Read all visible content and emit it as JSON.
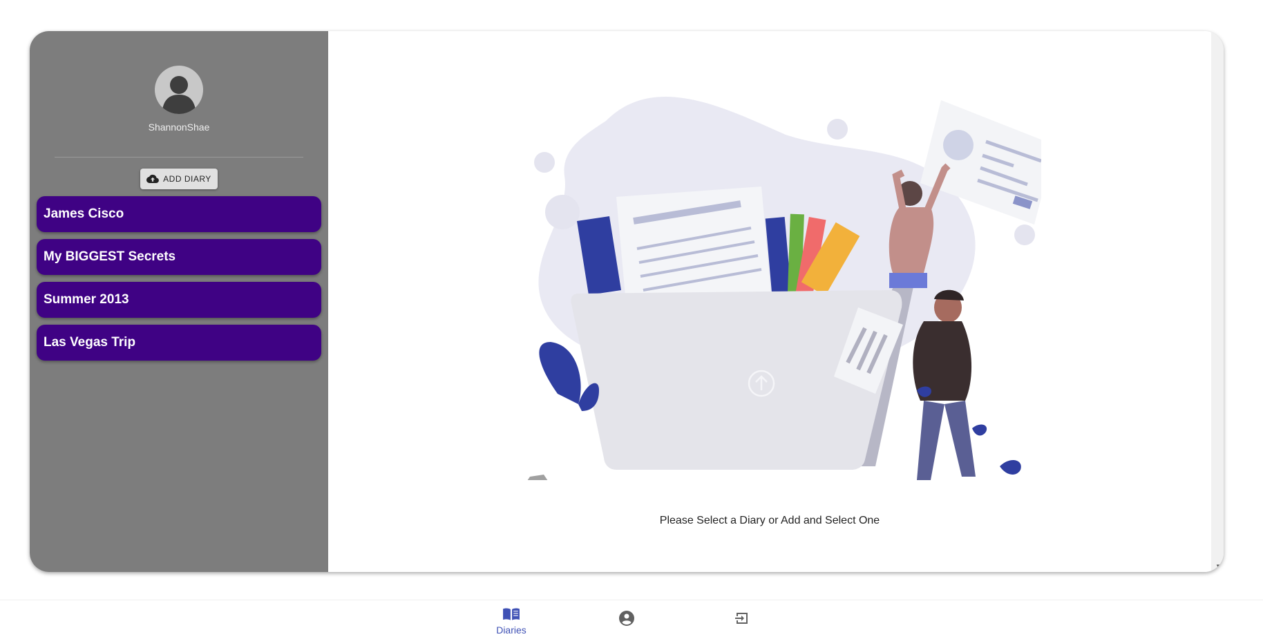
{
  "user": {
    "username": "ShannonShae"
  },
  "sidebar": {
    "add_button_label": "ADD DIARY",
    "diaries": [
      "James Cisco",
      "My BIGGEST Secrets",
      "Summer 2013",
      "Las Vegas Trip"
    ]
  },
  "main": {
    "prompt": "Please Select a Diary or Add and Select One"
  },
  "bottom_nav": {
    "items": [
      {
        "label": "Diaries",
        "icon": "book-icon",
        "active": true
      },
      {
        "label": "",
        "icon": "account-circle-icon",
        "active": false
      },
      {
        "label": "",
        "icon": "logout-icon",
        "active": false
      }
    ]
  },
  "colors": {
    "sidebar_bg": "#7d7d7d",
    "diary_item_bg": "#3f0284",
    "nav_active": "#3f51b5"
  }
}
